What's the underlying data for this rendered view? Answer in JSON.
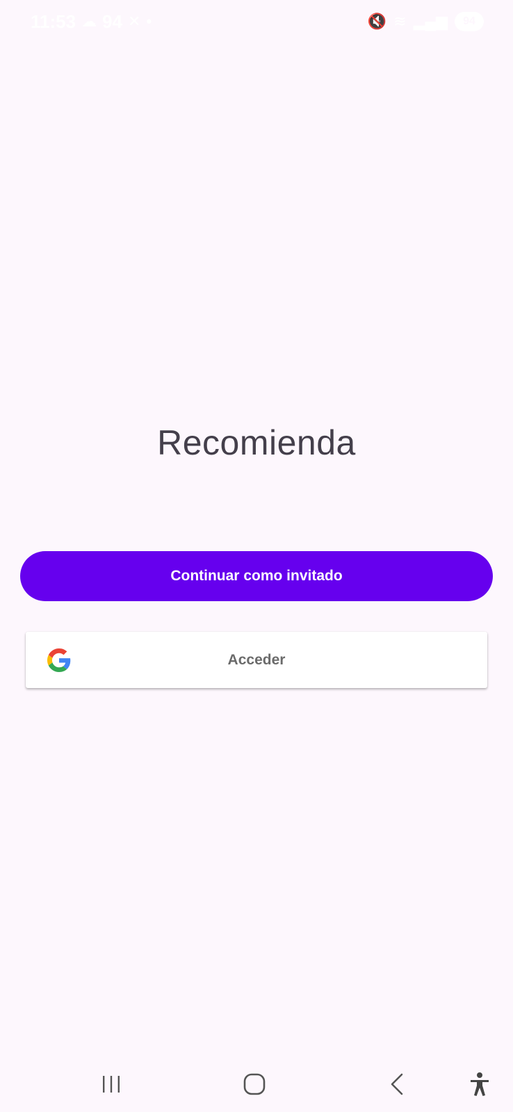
{
  "status_bar": {
    "time": "11:53",
    "left_icons": [
      "cloud-icon",
      "notification-icon",
      "close-x-icon",
      "dot-icon"
    ],
    "left_icon_text": "94",
    "battery": "94"
  },
  "main": {
    "title": "Recomienda",
    "guest_button_label": "Continuar como invitado",
    "google_button_label": "Acceder"
  },
  "colors": {
    "background": "#fdf7fd",
    "primary": "#6600ee",
    "title_text": "#443f4b"
  },
  "nav_bar": {
    "items": [
      "recent-apps-icon",
      "home-icon",
      "back-icon",
      "accessibility-icon"
    ]
  }
}
